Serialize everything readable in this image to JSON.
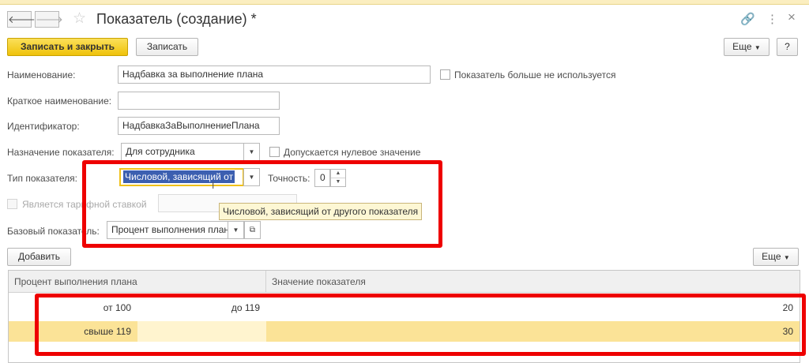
{
  "window": {
    "title": "Показатель (создание) *",
    "back_glyph": "🡐",
    "forward_glyph": "🡒",
    "star_glyph": "☆",
    "link_glyph": "🔗",
    "more_glyph": "⋮",
    "close_glyph": "×"
  },
  "toolbar": {
    "save_close_label": "Записать и закрыть",
    "save_label": "Записать",
    "more_label": "Еще",
    "help_label": "?"
  },
  "form": {
    "name_label": "Наименование:",
    "name_value": "Надбавка за выполнение плана",
    "not_used_label": "Показатель больше не используется",
    "short_name_label": "Краткое наименование:",
    "short_name_value": "",
    "id_label": "Идентификатор:",
    "id_value": "НадбавкаЗаВыполнениеПлана",
    "purpose_label": "Назначение показателя:",
    "purpose_value": "Для сотрудника",
    "zero_allowed_label": "Допускается нулевое значение",
    "type_label": "Тип показателя:",
    "type_value": "Числовой, зависящий от",
    "precision_label": "Точность:",
    "precision_value": "0",
    "tariff_label": "Является тарифной ставкой",
    "tooltip": "Числовой, зависящий от другого показателя",
    "base_label": "Базовый показатель:",
    "base_value": "Процент выполнения плана"
  },
  "table_toolbar": {
    "add_label": "Добавить",
    "more_label": "Еще"
  },
  "table": {
    "columns": [
      "Процент выполнения плана",
      "Значение показателя"
    ],
    "rows": [
      {
        "from": "от 100",
        "to": "до 119",
        "value": "20"
      },
      {
        "from": "свыше 119",
        "to": "",
        "value": "30"
      }
    ]
  },
  "colors": {
    "accent_yellow": "#f5cf26",
    "highlight_red": "#ee0000",
    "selected_row": "#fbe397"
  }
}
